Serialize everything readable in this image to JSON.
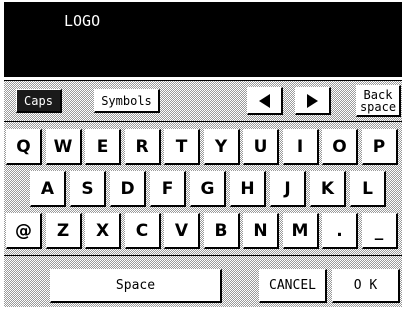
{
  "header": {
    "logo_text": "LOGO"
  },
  "toolbar": {
    "caps_label": "Caps",
    "symbols_label": "Symbols",
    "back_label_line1": "Back",
    "back_label_line2": "space"
  },
  "keyboard": {
    "row1": [
      "Q",
      "W",
      "E",
      "R",
      "T",
      "Y",
      "U",
      "I",
      "O",
      "P"
    ],
    "row2": [
      "A",
      "S",
      "D",
      "F",
      "G",
      "H",
      "J",
      "K",
      "L"
    ],
    "row3": [
      "@",
      "Z",
      "X",
      "C",
      "V",
      "B",
      "N",
      "M",
      ".",
      "_"
    ]
  },
  "bottom": {
    "space_label": "Space",
    "cancel_label": "CANCEL",
    "ok_label": "O K"
  },
  "icons": {
    "left": "arrow-left-icon",
    "right": "arrow-right-icon"
  }
}
